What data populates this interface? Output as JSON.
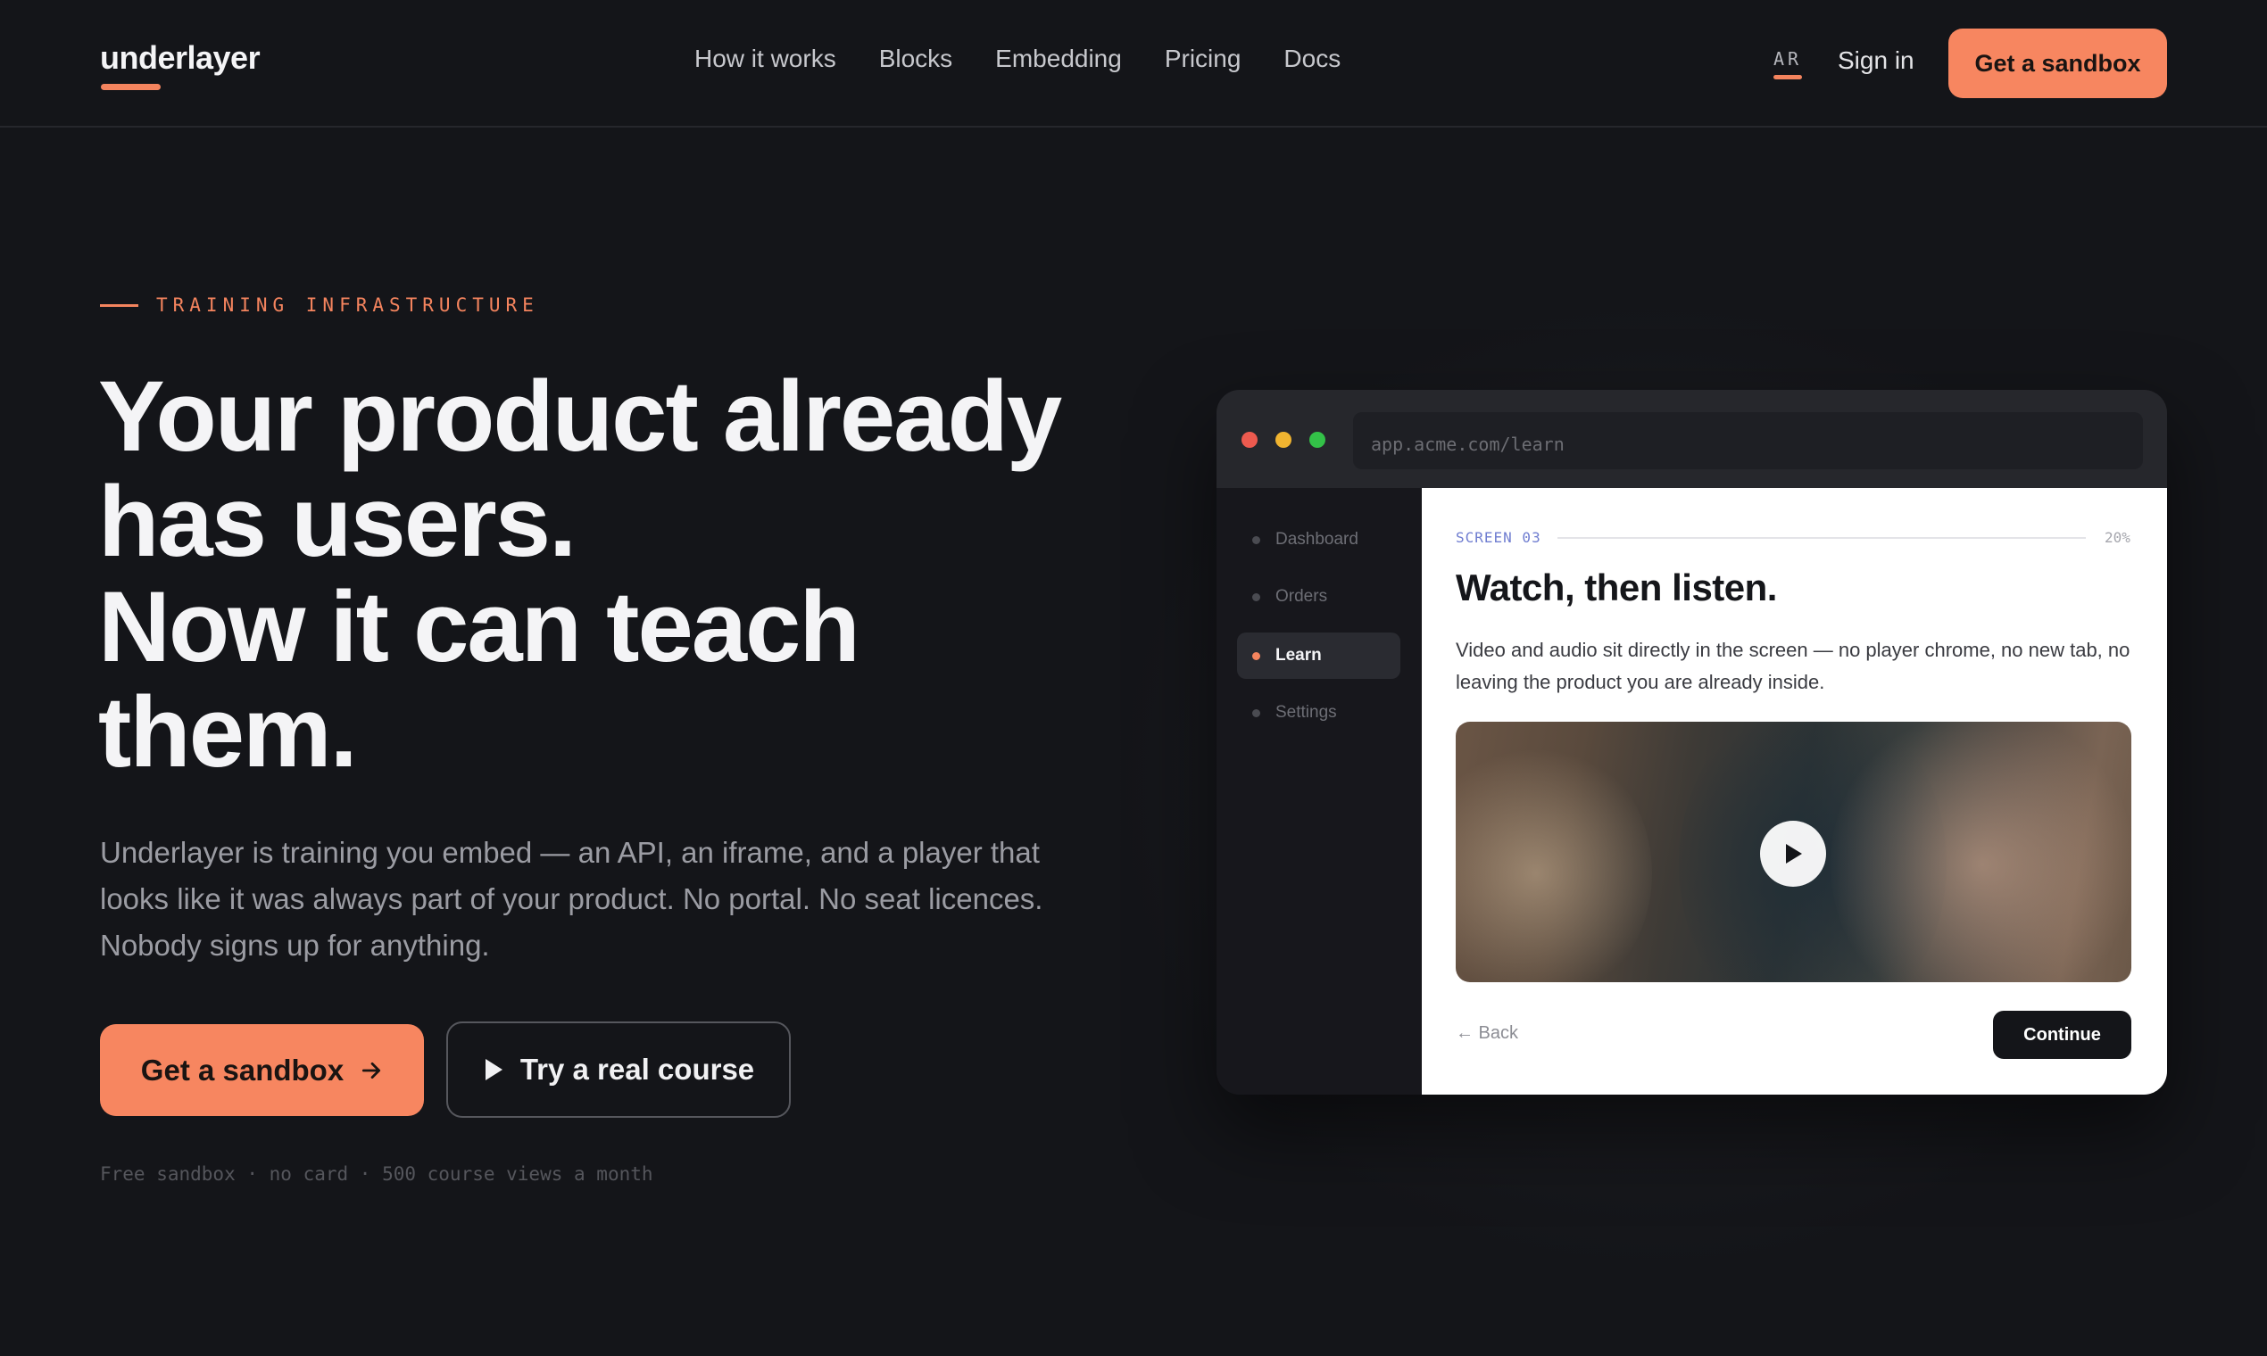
{
  "nav": {
    "logo": "underlayer",
    "links": [
      "How it works",
      "Blocks",
      "Embedding",
      "Pricing",
      "Docs"
    ],
    "language": "AR",
    "sign_in": "Sign in",
    "cta": "Get a sandbox"
  },
  "hero": {
    "eyebrow": "TRAINING INFRASTRUCTURE",
    "headline": [
      "Your product already",
      "has users.",
      "Now it can teach",
      "them."
    ],
    "subcopy": "Underlayer is training you embed — an API, an iframe, and a player that looks like it was always part of your product. No portal. No seat licences. Nobody signs up for anything.",
    "primary_cta": "Get a sandbox",
    "secondary_cta": "Try a real course",
    "fine_print": "Free sandbox · no card · 500 course views a month"
  },
  "mock": {
    "url": "app.acme.com/learn",
    "sidebar": [
      "Dashboard",
      "Orders",
      "Learn",
      "Settings"
    ],
    "active_item": "Learn",
    "screen_label": "SCREEN 03",
    "progress_label": "20%",
    "progress": 0.2,
    "title": "Watch, then listen.",
    "description": "Video and audio sit directly in the screen — no player chrome, no new tab, no leaving the product you are already inside.",
    "back": "← Back",
    "continue": "Continue"
  },
  "colors": {
    "background": "#141519",
    "accent": "#f78660",
    "traffic_red": "#ed5a4f",
    "traffic_yellow": "#f0b430",
    "traffic_green": "#33c148",
    "screen_label": "#6f7dd0"
  }
}
